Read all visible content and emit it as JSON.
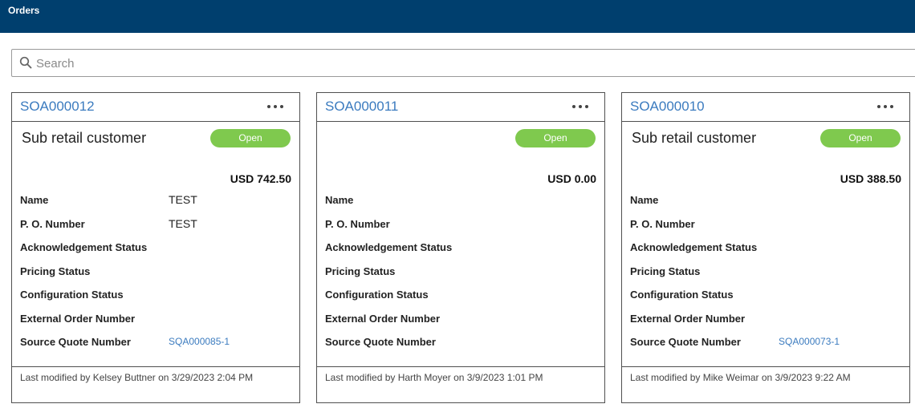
{
  "header": {
    "title": "Orders"
  },
  "search": {
    "placeholder": "Search",
    "value": ""
  },
  "labels": {
    "name": "Name",
    "po_number": "P. O. Number",
    "ack_status": "Acknowledgement Status",
    "pricing_status": "Pricing Status",
    "config_status": "Configuration Status",
    "external_order": "External Order Number",
    "source_quote": "Source Quote Number"
  },
  "colors": {
    "header": "#003f6e",
    "link": "#3b7bbf",
    "status_open": "#7fc94e"
  },
  "icons": {
    "search": "search-icon",
    "more": "more-options-icon"
  },
  "cards": [
    {
      "id": "SOA000012",
      "customer": "Sub retail customer",
      "status": "Open",
      "amount": "USD 742.50",
      "name": "TEST",
      "po_number": "TEST",
      "source_quote": "SQA000085-1",
      "modified": "Last modified by Kelsey Buttner on 3/29/2023 2:04 PM"
    },
    {
      "id": "SOA000011",
      "customer": "",
      "status": "Open",
      "amount": "USD 0.00",
      "name": "",
      "po_number": "",
      "source_quote": "",
      "modified": "Last modified by Harth Moyer on 3/9/2023 1:01 PM"
    },
    {
      "id": "SOA000010",
      "customer": "Sub retail customer",
      "status": "Open",
      "amount": "USD 388.50",
      "name": "",
      "po_number": "",
      "source_quote": "SQA000073-1",
      "modified": "Last modified by Mike Weimar on 3/9/2023 9:22 AM"
    }
  ]
}
